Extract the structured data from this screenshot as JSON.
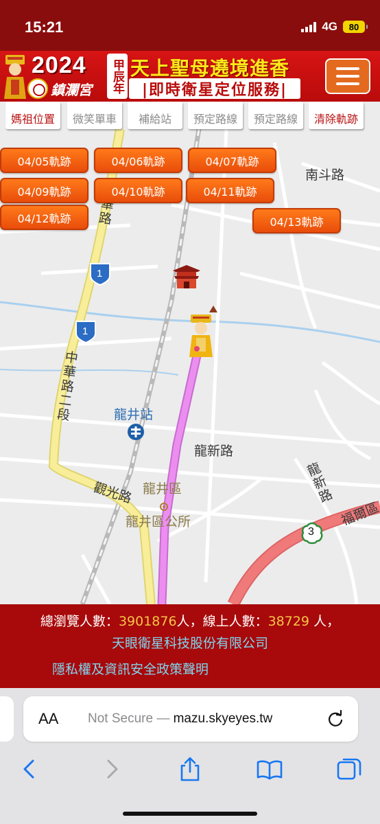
{
  "status_bar": {
    "time": "15:21",
    "network": "4G",
    "battery": "80"
  },
  "banner": {
    "year": "2024",
    "cyclic_year": "甲辰年",
    "headline": "天上聖母遶境進香",
    "subheadline": "|即時衛星定位服務|",
    "temple_name": "鎮瀾宮",
    "menu_icon": "hamburger-menu-icon"
  },
  "tools": [
    {
      "label": "媽祖位置",
      "active": true
    },
    {
      "label": "微笑單車",
      "active": false
    },
    {
      "label": "補給站",
      "active": false
    },
    {
      "label": "預定路線",
      "active": false
    },
    {
      "label": "預定路線",
      "active": false
    },
    {
      "label": "清除軌跡",
      "active": true
    }
  ],
  "trace_buttons": [
    "04/05軌跡",
    "04/06軌跡",
    "04/07軌跡",
    "04/09軌跡",
    "04/10軌跡",
    "04/11軌跡",
    "04/12軌跡",
    "04/13軌跡"
  ],
  "map": {
    "labels": {
      "nandou_road": "南斗路",
      "zhonghua_road": "中華路",
      "zhonghua_road_sec2": "中華路二段",
      "route_1_a": "1",
      "route_1_b": "1",
      "longjing_station": "龍井站",
      "longxin_road": "龍新路",
      "longjing_district": "龍井區",
      "district_office": "龍井區公所",
      "guanguang_road": "觀光路",
      "longxin_road_v": "龍新路",
      "fuyi_road": "福爾區",
      "route_3": "3"
    },
    "route_color": "#ec8ef0",
    "highway_color": "#f07a7a",
    "main_road_color": "#f8ee9a"
  },
  "footer": {
    "visitors_label": "總瀏覽人數：",
    "visitors_count": "3901876",
    "visitors_unit": "人，線上人數：",
    "online_count": "38729",
    "online_unit": " 人，",
    "company": "天眼衛星科技股份有限公司",
    "privacy": "隱私權及資訊安全政策聲明"
  },
  "browser": {
    "aa_label": "AA",
    "not_secure": "Not Secure — ",
    "host": "mazu.skyeyes.tw"
  }
}
